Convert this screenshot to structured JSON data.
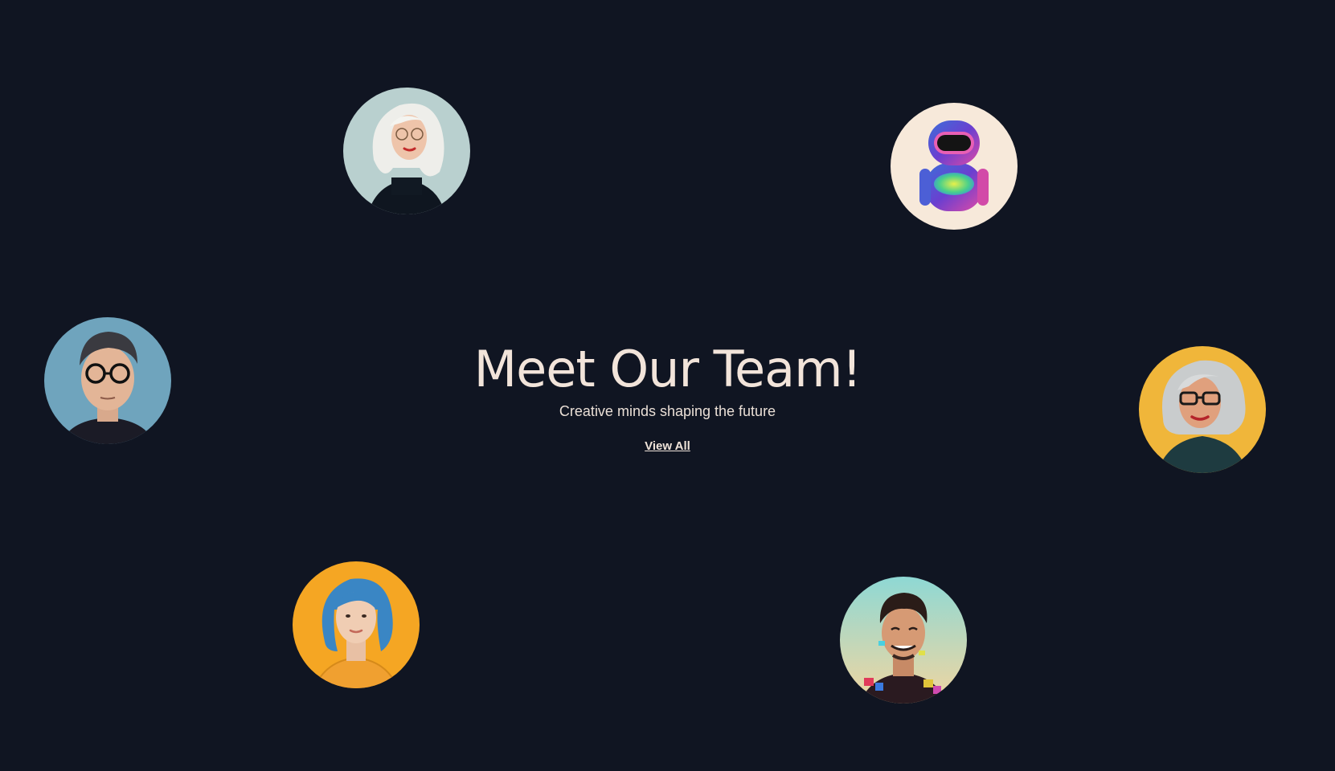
{
  "hero": {
    "title": "Meet Our Team!",
    "subtitle": "Creative minds shaping the future",
    "link_label": "View All"
  },
  "colors": {
    "background": "#101522",
    "text": "#f2e4da"
  },
  "avatars": [
    {
      "icon": "woman-white-hair-glasses-portrait",
      "bg": "#b9d0cf"
    },
    {
      "icon": "robot-mascot-portrait",
      "bg": "#f7e9da"
    },
    {
      "icon": "man-glasses-portrait",
      "bg": "#6fa4bd"
    },
    {
      "icon": "woman-gray-hair-glasses-portrait",
      "bg": "#f0b63a"
    },
    {
      "icon": "woman-blue-hair-portrait",
      "bg": "#f5a623"
    },
    {
      "icon": "man-smiling-glitch-portrait",
      "bg": "#9fd8d3"
    }
  ]
}
